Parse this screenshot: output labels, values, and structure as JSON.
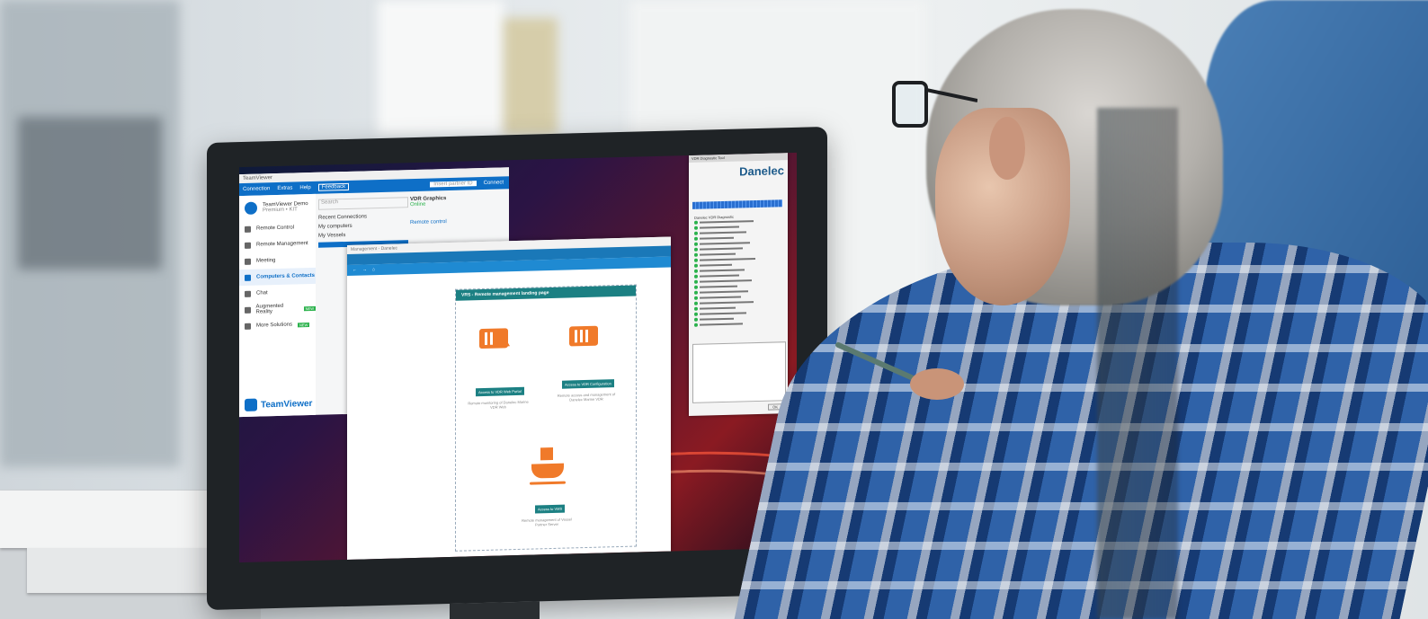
{
  "teamviewer": {
    "window_title": "TeamViewer",
    "menu": [
      "Connection",
      "Extras",
      "Help",
      "Feedback"
    ],
    "user_name": "TeamViewer Demo",
    "user_status": "Premium • KIT",
    "partner_id_placeholder": "Insert partner ID",
    "connect_label": "Connect",
    "sidebar": [
      {
        "label": "Remote Control",
        "active": false
      },
      {
        "label": "Remote Management",
        "active": false
      },
      {
        "label": "Meeting",
        "active": false
      },
      {
        "label": "Computers & Contacts",
        "active": true
      },
      {
        "label": "Chat",
        "active": false
      },
      {
        "label": "Augmented Reality",
        "active": false,
        "badge": "NEW"
      },
      {
        "label": "More Solutions",
        "active": false,
        "badge": "NEW"
      }
    ],
    "search_placeholder": "Search",
    "tree": [
      "Recent Connections",
      "My computers",
      "My Vessels"
    ],
    "detail_title": "VDR Graphics",
    "detail_status": "Online",
    "detail_action": "Remote control",
    "brand": "TeamViewer"
  },
  "management_page": {
    "window_title": "Management - Danelec",
    "card_title": "VRS - Remote management landing page",
    "items": [
      {
        "button": "Access to VDR Web Portal",
        "caption": "Remote monitoring of Danelec Marine VDR Web"
      },
      {
        "button": "Access to VDR Configuration",
        "caption": "Remote access and management of Danelec Marine VDR"
      },
      {
        "button": "Access to VMS",
        "caption": "Remote management of Vessel Partner Server"
      }
    ],
    "accent_color": "#f07a2a",
    "header_color": "#1c8083"
  },
  "danelec_tool": {
    "window_title": "VDR Diagnostic Tool",
    "logo": "Danelec",
    "tree_root": "Danelec VDR Diagnostic",
    "ok_label": "OK"
  }
}
